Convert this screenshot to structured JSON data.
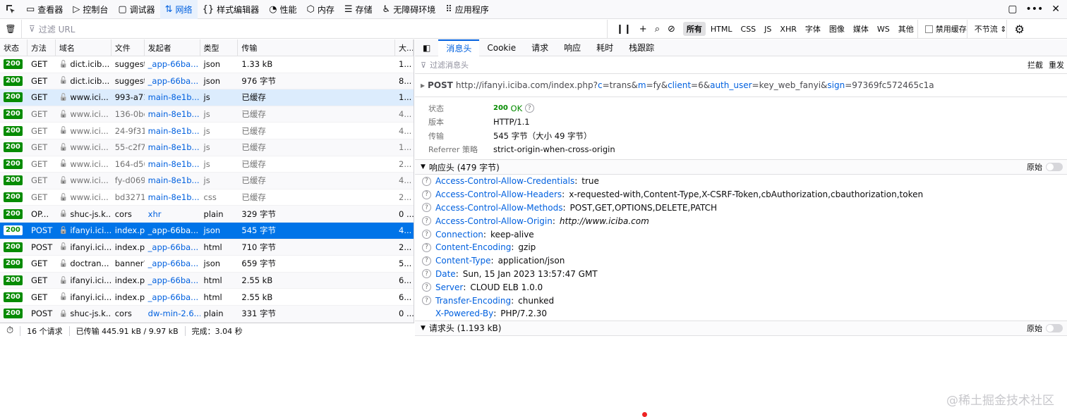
{
  "toolbar": {
    "tabs": [
      {
        "icon": "inspector-icon",
        "label": "查看器"
      },
      {
        "icon": "console-icon",
        "label": "控制台"
      },
      {
        "icon": "debugger-icon",
        "label": "调试器"
      },
      {
        "icon": "network-icon",
        "label": "网络"
      },
      {
        "icon": "style-editor-icon",
        "label": "样式编辑器"
      },
      {
        "icon": "performance-icon",
        "label": "性能"
      },
      {
        "icon": "memory-icon",
        "label": "内存"
      },
      {
        "icon": "storage-icon",
        "label": "存储"
      },
      {
        "icon": "accessibility-icon",
        "label": "无障碍环境"
      },
      {
        "icon": "application-icon",
        "label": "应用程序"
      }
    ],
    "selected": "网络"
  },
  "filterbar": {
    "placeholder": "过滤 URL",
    "types": [
      "所有",
      "HTML",
      "CSS",
      "JS",
      "XHR",
      "字体",
      "图像",
      "媒体",
      "WS",
      "其他"
    ],
    "selected_type": "所有",
    "disable_cache": "禁用缓存",
    "throttle": "不节流 ⇕"
  },
  "table": {
    "headers": [
      "状态",
      "方法",
      "域名",
      "文件",
      "发起者",
      "类型",
      "传输",
      "大..."
    ],
    "rows": [
      {
        "status": "200",
        "method": "GET",
        "domain": "dict.icib...",
        "file": "suggest",
        "initiator": "_app-66ba...",
        "type": "json",
        "transfer": "1.33 kB",
        "size": "1...",
        "insecure": true,
        "cached": false
      },
      {
        "status": "200",
        "method": "GET",
        "domain": "dict.icib...",
        "file": "suggest",
        "initiator": "_app-66ba...",
        "type": "json",
        "transfer": "976 字节",
        "size": "8...",
        "insecure": true,
        "cached": false
      },
      {
        "status": "200",
        "method": "GET",
        "domain": "www.ici...",
        "file": "993-a71",
        "initiator": "main-8e1b...",
        "type": "js",
        "transfer": "已缓存",
        "size": "1...",
        "insecure": true,
        "cached": false
      },
      {
        "status": "200",
        "method": "GET",
        "domain": "www.ici...",
        "file": "136-0be",
        "initiator": "main-8e1b...",
        "type": "js",
        "transfer": "已缓存",
        "size": "4...",
        "insecure": true,
        "cached": true
      },
      {
        "status": "200",
        "method": "GET",
        "domain": "www.ici...",
        "file": "24-9f31l",
        "initiator": "main-8e1b...",
        "type": "js",
        "transfer": "已缓存",
        "size": "4...",
        "insecure": true,
        "cached": true
      },
      {
        "status": "200",
        "method": "GET",
        "domain": "www.ici...",
        "file": "55-c2f79",
        "initiator": "main-8e1b...",
        "type": "js",
        "transfer": "已缓存",
        "size": "1...",
        "insecure": true,
        "cached": true
      },
      {
        "status": "200",
        "method": "GET",
        "domain": "www.ici...",
        "file": "164-d50",
        "initiator": "main-8e1b...",
        "type": "js",
        "transfer": "已缓存",
        "size": "2...",
        "insecure": true,
        "cached": true
      },
      {
        "status": "200",
        "method": "GET",
        "domain": "www.ici...",
        "file": "fy-d069",
        "initiator": "main-8e1b...",
        "type": "js",
        "transfer": "已缓存",
        "size": "4...",
        "insecure": true,
        "cached": true
      },
      {
        "status": "200",
        "method": "GET",
        "domain": "www.ici...",
        "file": "bd32715",
        "initiator": "main-8e1b...",
        "type": "css",
        "transfer": "已缓存",
        "size": "2...",
        "insecure": true,
        "cached": true
      },
      {
        "status": "200",
        "method": "OP...",
        "domain": "shuc-js.k...",
        "file": "cors",
        "initiator": "xhr",
        "type": "plain",
        "transfer": "329 字节",
        "size": "0 ...",
        "insecure": false,
        "cached": false
      },
      {
        "status": "200",
        "method": "POST",
        "domain": "ifanyi.ici...",
        "file": "index.ph",
        "initiator": "_app-66ba...",
        "type": "json",
        "transfer": "545 字节",
        "size": "4...",
        "insecure": true,
        "cached": false
      },
      {
        "status": "200",
        "method": "POST",
        "domain": "ifanyi.ici...",
        "file": "index.ph",
        "initiator": "_app-66ba...",
        "type": "html",
        "transfer": "710 字节",
        "size": "2...",
        "insecure": true,
        "cached": false
      },
      {
        "status": "200",
        "method": "GET",
        "domain": "doctran...",
        "file": "banner?",
        "initiator": "_app-66ba...",
        "type": "json",
        "transfer": "659 字节",
        "size": "5...",
        "insecure": true,
        "cached": false
      },
      {
        "status": "200",
        "method": "GET",
        "domain": "ifanyi.ici...",
        "file": "index.ph",
        "initiator": "_app-66ba...",
        "type": "html",
        "transfer": "2.55 kB",
        "size": "6...",
        "insecure": true,
        "cached": false
      },
      {
        "status": "200",
        "method": "GET",
        "domain": "ifanyi.ici...",
        "file": "index.ph",
        "initiator": "_app-66ba...",
        "type": "html",
        "transfer": "2.55 kB",
        "size": "6...",
        "insecure": true,
        "cached": false
      },
      {
        "status": "200",
        "method": "POST",
        "domain": "shuc-js.k...",
        "file": "cors",
        "initiator": "dw-min-2.6...",
        "type": "plain",
        "transfer": "331 字节",
        "size": "0 ...",
        "insecure": false,
        "cached": false
      }
    ],
    "highlighted_row": 2,
    "selected_row": 10
  },
  "statusbar": {
    "requests": "16 个请求",
    "transferred": "已传输 445.91 kB / 9.97 kB",
    "finish": "完成：3.04 秒"
  },
  "details": {
    "tabs": [
      "消息头",
      "Cookie",
      "请求",
      "响应",
      "耗时",
      "栈跟踪"
    ],
    "selected_tab": "消息头",
    "filter_placeholder": "过滤消息头",
    "block_label": "拦截",
    "resend_label": "重发",
    "request_method": "POST",
    "request_url_parts": [
      {
        "t": "http://ifanyi.iciba.com/index.php?",
        "k": false
      },
      {
        "t": "c",
        "k": true
      },
      {
        "t": "=trans&",
        "k": false
      },
      {
        "t": "m",
        "k": true
      },
      {
        "t": "=fy&",
        "k": false
      },
      {
        "t": "client",
        "k": true
      },
      {
        "t": "=6&",
        "k": false
      },
      {
        "t": "auth_user",
        "k": true
      },
      {
        "t": "=key_web_fanyi&",
        "k": false
      },
      {
        "t": "sign",
        "k": true
      },
      {
        "t": "=97369fc572465c1a",
        "k": false
      }
    ],
    "summary": {
      "status_label": "状态",
      "status_code": "200",
      "status_text": "OK",
      "version_label": "版本",
      "version": "HTTP/1.1",
      "transfer_label": "传输",
      "transfer": "545 字节（大小 49 字节）",
      "referrer_label": "Referrer 策略",
      "referrer": "strict-origin-when-cross-origin"
    },
    "response_headers_title": "响应头 (479 字节)",
    "raw_label": "原始",
    "response_headers": [
      {
        "name": "Access-Control-Allow-Credentials",
        "value": "true",
        "italic": false,
        "help": true
      },
      {
        "name": "Access-Control-Allow-Headers",
        "value": "x-requested-with,Content-Type,X-CSRF-Token,cbAuthorization,cbauthorization,token",
        "italic": false,
        "help": true
      },
      {
        "name": "Access-Control-Allow-Methods",
        "value": "POST,GET,OPTIONS,DELETE,PATCH",
        "italic": false,
        "help": true
      },
      {
        "name": "Access-Control-Allow-Origin",
        "value": "http://www.iciba.com",
        "italic": true,
        "help": true
      },
      {
        "name": "Connection",
        "value": "keep-alive",
        "italic": false,
        "help": true
      },
      {
        "name": "Content-Encoding",
        "value": "gzip",
        "italic": false,
        "help": true
      },
      {
        "name": "Content-Type",
        "value": "application/json",
        "italic": false,
        "help": true
      },
      {
        "name": "Date",
        "value": "Sun, 15 Jan 2023 13:57:47 GMT",
        "italic": false,
        "help": true
      },
      {
        "name": "Server",
        "value": "CLOUD ELB 1.0.0",
        "italic": false,
        "help": true
      },
      {
        "name": "Transfer-Encoding",
        "value": "chunked",
        "italic": false,
        "help": true
      },
      {
        "name": "X-Powered-By",
        "value": "PHP/7.2.30",
        "italic": false,
        "help": false
      }
    ],
    "request_headers_title": "请求头 (1.193 kB)"
  },
  "watermark": "@稀土掘金技术社区"
}
